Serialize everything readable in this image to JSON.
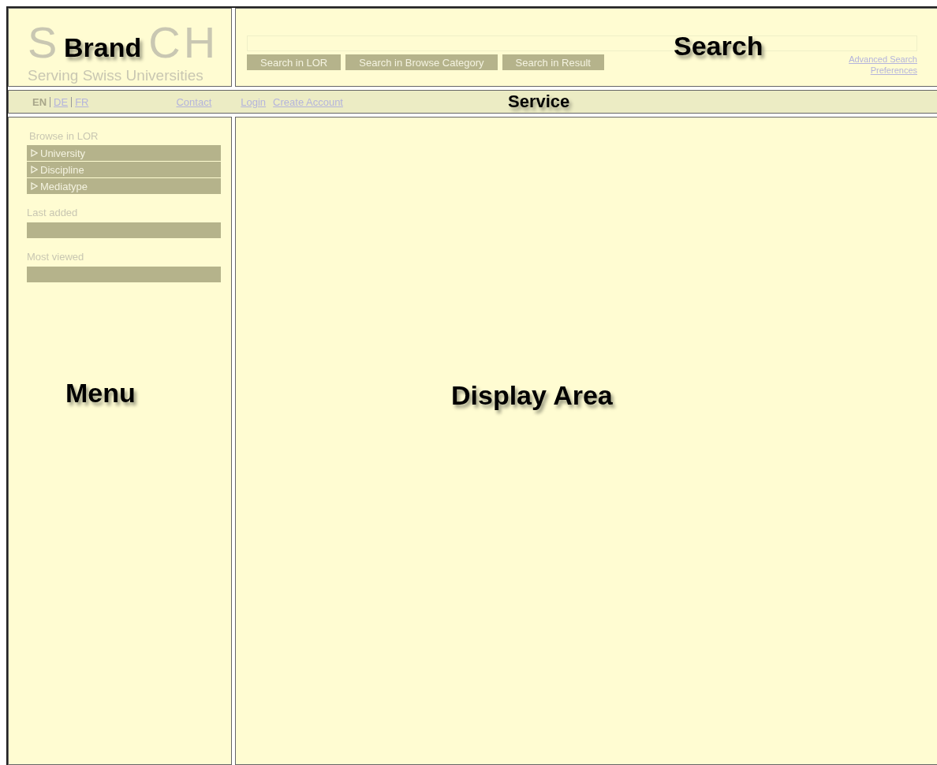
{
  "brand": {
    "logo_parts": [
      "S",
      "CH"
    ],
    "tagline": "Serving Swiss Universities",
    "label": "Brand"
  },
  "search": {
    "buttons": [
      "Search in LOR",
      "Search in Browse Category",
      "Search in Result"
    ],
    "links": [
      "Advanced Search",
      "Preferences"
    ],
    "label": "Search"
  },
  "service": {
    "languages": [
      {
        "label": "EN",
        "selected": true
      },
      {
        "label": "DE",
        "selected": false
      },
      {
        "label": "FR",
        "selected": false
      }
    ],
    "contact": "Contact",
    "account_links": [
      "Login",
      "Create Account"
    ],
    "label": "Service"
  },
  "menu": {
    "heading": "Browse in LOR",
    "categories": [
      {
        "label": "University",
        "expanded": false
      },
      {
        "label": "Discipline",
        "expanded": false
      },
      {
        "label": "Mediatype",
        "expanded": false
      }
    ],
    "sections": [
      {
        "heading": "Last added"
      },
      {
        "heading": "Most viewed"
      }
    ],
    "label": "Menu"
  },
  "display": {
    "label": "Display Area"
  }
}
